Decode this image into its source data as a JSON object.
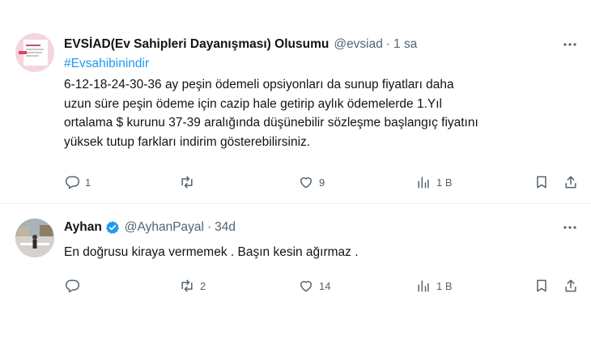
{
  "tweets": [
    {
      "display_name": "EVSİAD(Ev Sahipleri Dayanışması) Olusumu",
      "handle": "@evsiad",
      "separator": "·",
      "time": "1 sa",
      "hashtag": "#Evsahibinindir",
      "text_lines": [
        "6-12-18-24-30-36 ay peşin ödemeli opsiyonları da sunup fiyatları daha",
        "uzun süre peşin ödeme için cazip hale getirip  aylık ödemelerde 1.Yıl",
        "ortalama $ kurunu 37-39 aralığında düşünebilir sözleşme başlangıç fiyatını",
        "yüksek tutup farkları indirim gösterebilirsiniz."
      ],
      "replies": "1",
      "retweets": "",
      "likes": "9",
      "views": "1 B",
      "verified": false
    },
    {
      "display_name": "Ayhan",
      "handle": "@AyhanPayal",
      "separator": "·",
      "time": "34d",
      "text_lines": [
        "En doğrusu kiraya vermemek . Başın kesin ağırmaz ."
      ],
      "replies": "",
      "retweets": "2",
      "likes": "14",
      "views": "1 B",
      "verified": true
    }
  ],
  "colors": {
    "text": "#0f1419",
    "secondary": "#536471",
    "link": "#1d9bf0",
    "verified": "#1d9bf0",
    "divider": "#eff3f4"
  },
  "icons": [
    "reply-icon",
    "retweet-icon",
    "like-icon",
    "views-icon",
    "bookmark-icon",
    "share-icon",
    "more-icon",
    "verified-badge-icon"
  ]
}
